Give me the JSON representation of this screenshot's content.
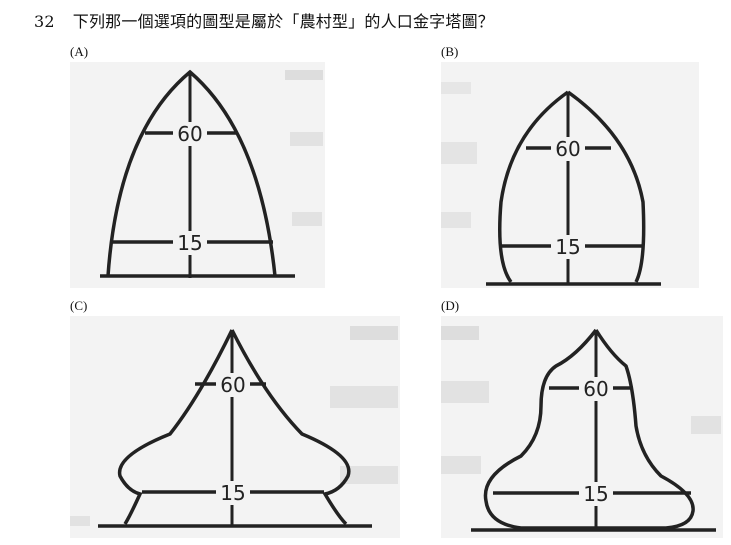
{
  "question": {
    "number": "32",
    "text": "下列那一個選項的圖型是屬於「農村型」的人口金字塔圖？"
  },
  "options": [
    {
      "label": "(A)",
      "upper_value": "60",
      "lower_value": "15"
    },
    {
      "label": "(B)",
      "upper_value": "60",
      "lower_value": "15"
    },
    {
      "label": "(C)",
      "upper_value": "60",
      "lower_value": "15"
    },
    {
      "label": "(D)",
      "upper_value": "60",
      "lower_value": "15"
    }
  ]
}
